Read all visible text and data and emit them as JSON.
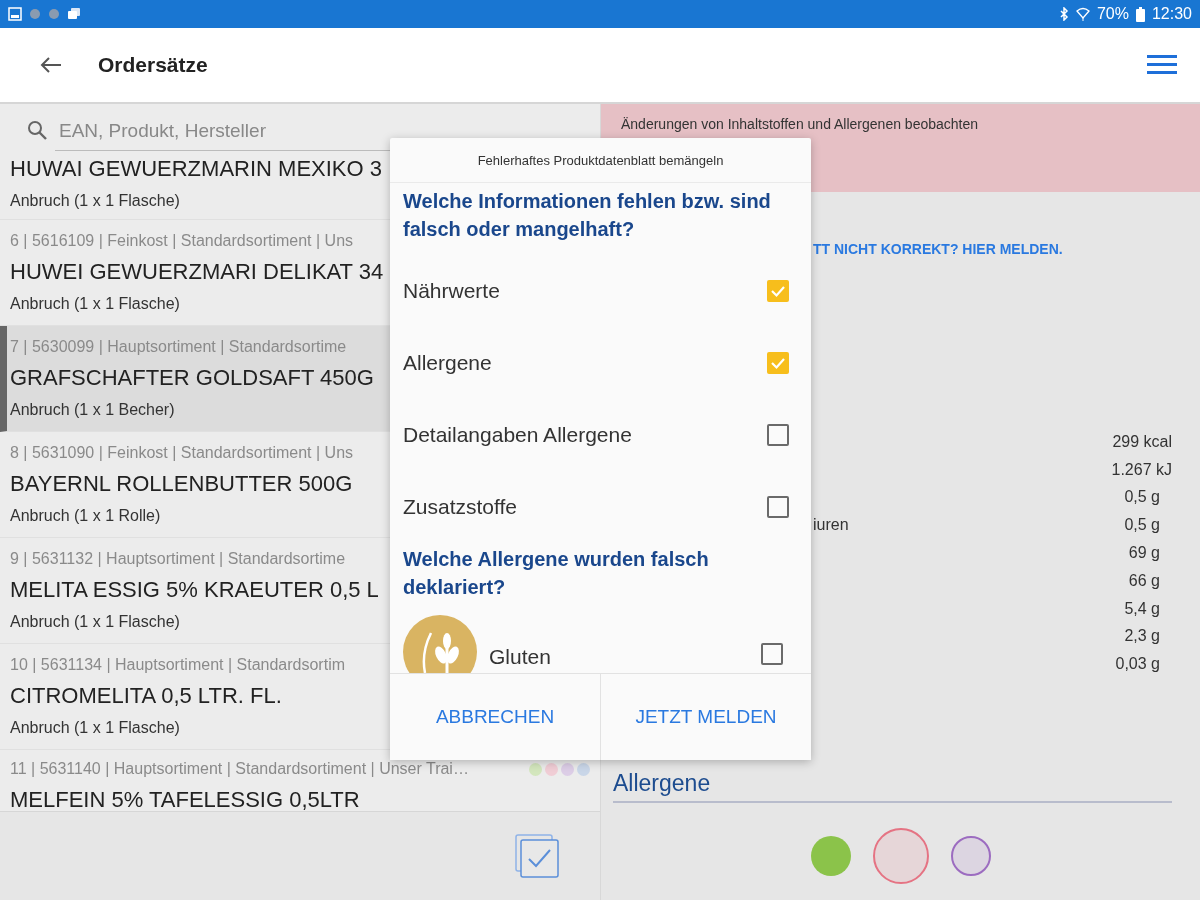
{
  "status_bar": {
    "battery": "70%",
    "time": "12:30"
  },
  "app_bar": {
    "title": "Ordersätze"
  },
  "search": {
    "placeholder": "EAN, Produkt, Hersteller"
  },
  "products": [
    {
      "name": "HUWAI GEWUERZMARIN MEXIKO 3",
      "unit": "Anbruch (1 x 1 Flasche)",
      "selected": false
    },
    {
      "meta": "6 | 5616109 | Feinkost | Standardsortiment | Uns",
      "name": "HUWEI GEWUERZMARI DELIKAT 34",
      "unit": "Anbruch (1 x 1 Flasche)",
      "selected": false
    },
    {
      "meta": "7 | 5630099 | Hauptsortiment | Standardsortime",
      "name": "GRAFSCHAFTER GOLDSAFT 450G",
      "unit": "Anbruch (1 x 1 Becher)",
      "selected": true
    },
    {
      "meta": "8 | 5631090 | Feinkost | Standardsortiment | Uns",
      "name": "BAYERNL ROLLENBUTTER 500G",
      "unit": "Anbruch (1 x 1 Rolle)",
      "selected": false
    },
    {
      "meta": "9 | 5631132 | Hauptsortiment | Standardsortime",
      "name": "MELITA ESSIG 5% KRAEUTER 0,5 L",
      "unit": "Anbruch (1 x 1 Flasche)",
      "selected": false
    },
    {
      "meta": "10 | 5631134 | Hauptsortiment | Standardsortim",
      "name": "CITROMELITA 0,5 LTR. FL.",
      "unit": "Anbruch (1 x 1 Flasche)",
      "selected": false
    },
    {
      "meta": "11 | 5631140 | Hauptsortiment | Standardsortiment | Unser Trai…",
      "name": "MELFEIN 5% TAFELESSIG 0,5LTR",
      "selected": false,
      "dots": [
        {
          "color": "#d3e6bd"
        },
        {
          "color": "#f0cdd5"
        },
        {
          "color": "#dccde6"
        },
        {
          "color": "#c9d6e8"
        }
      ]
    }
  ],
  "detail": {
    "banner": "Änderungen von Inhaltstoffen und Allergenen beobachten",
    "report_link": "TT NICHT KORREKT? HIER MELDEN.",
    "nutrition": [
      {
        "value": "299 kcal"
      },
      {
        "value": "1.267 kJ"
      },
      {
        "value": "0,5 g"
      },
      {
        "label": "iuren",
        "value": "0,5 g"
      },
      {
        "value": "69 g"
      },
      {
        "value": "66 g"
      },
      {
        "value": "5,4 g"
      },
      {
        "value": "2,3 g"
      },
      {
        "value": "0,03 g"
      }
    ],
    "section": "Allergene",
    "circles": [
      {
        "kind": "filled",
        "color": "#8bc34a"
      },
      {
        "kind": "ring",
        "color": "#e57383"
      },
      {
        "kind": "ring",
        "color": "#9c6cc0"
      }
    ]
  },
  "dialog": {
    "title": "Fehlerhaftes Produktdatenblatt bemängeln",
    "question_1": "Welche Informationen fehlen bzw. sind falsch oder mangelhaft?",
    "options": [
      {
        "label": "Nährwerte",
        "checked": true
      },
      {
        "label": "Allergene",
        "checked": true
      },
      {
        "label": "Detailangaben Allergene",
        "checked": false
      },
      {
        "label": "Zusatzstoffe",
        "checked": false
      }
    ],
    "question_2": "Welche Allergene wurden falsch deklariert?",
    "allergens": [
      {
        "label": "Gluten",
        "checked": false
      }
    ],
    "buttons": [
      "ABBRECHEN",
      "JETZT MELDEN"
    ]
  }
}
